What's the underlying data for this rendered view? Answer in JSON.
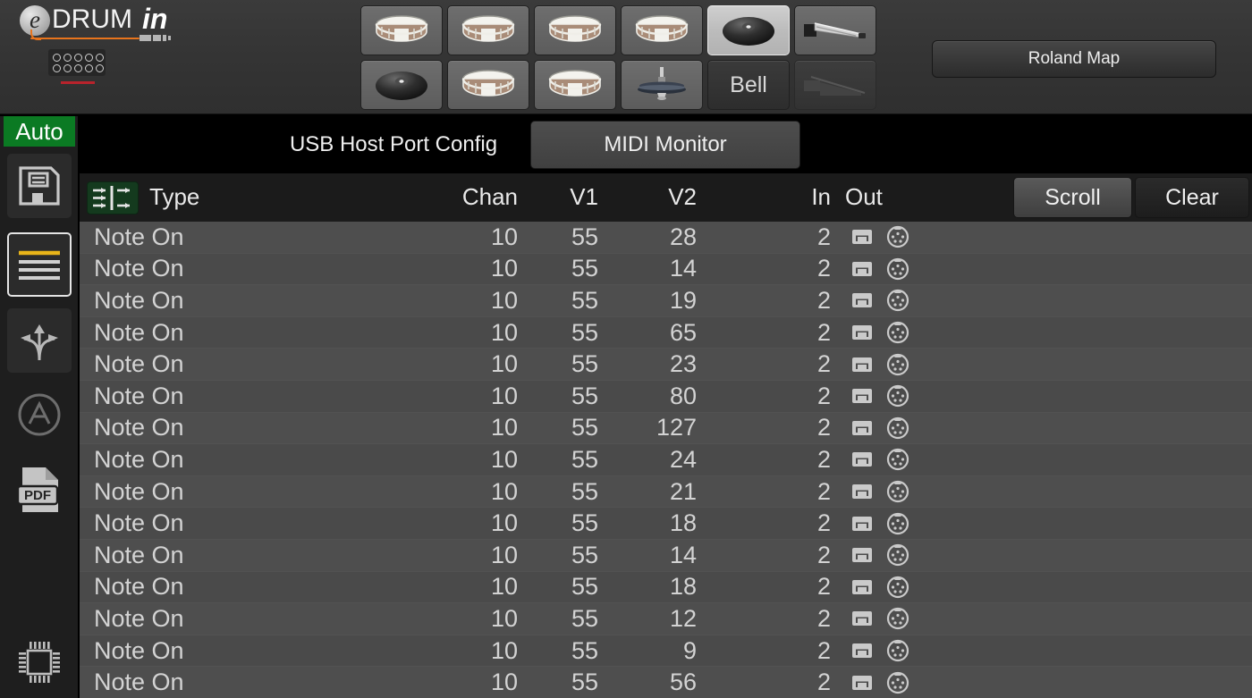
{
  "app": {
    "brand_e": "e",
    "brand_drum": "DRUM",
    "brand_in": "in"
  },
  "colors": {
    "accent_orange": "#e8741c",
    "accent_red": "#b8232c",
    "auto_green": "#0b7a23",
    "filter_green": "#143a1e",
    "table_body_bg": "#4c4c4c",
    "selected_pad_bg": "#bcbcbc"
  },
  "topbar": {
    "pads": {
      "row1": [
        {
          "name": "pad-1",
          "icon": "snare-drum-icon",
          "label": "",
          "state": "normal"
        },
        {
          "name": "pad-2",
          "icon": "snare-drum-icon",
          "label": "",
          "state": "normal"
        },
        {
          "name": "pad-3",
          "icon": "snare-drum-icon",
          "label": "",
          "state": "normal"
        },
        {
          "name": "pad-4",
          "icon": "snare-drum-icon",
          "label": "",
          "state": "normal"
        },
        {
          "name": "pad-5",
          "icon": "cymbal-icon",
          "label": "",
          "state": "selected"
        },
        {
          "name": "pad-6",
          "icon": "hihat-pedal-icon",
          "label": "",
          "state": "normal"
        }
      ],
      "row2": [
        {
          "name": "pad-7",
          "icon": "cymbal-icon",
          "label": "",
          "state": "normal"
        },
        {
          "name": "pad-8",
          "icon": "snare-drum-icon",
          "label": "",
          "state": "normal"
        },
        {
          "name": "pad-9",
          "icon": "snare-drum-icon",
          "label": "",
          "state": "normal"
        },
        {
          "name": "pad-10",
          "icon": "hihat-icon",
          "label": "",
          "state": "normal"
        },
        {
          "name": "pad-11-bell",
          "icon": "",
          "label": "Bell",
          "state": "dark"
        },
        {
          "name": "pad-12",
          "icon": "hihat-pedal-icon",
          "label": "",
          "state": "disabled"
        }
      ]
    },
    "roland_map_label": "Roland Map"
  },
  "sidebar": {
    "auto_label": "Auto",
    "items": [
      {
        "name": "sidebar-item-save",
        "icon": "floppy-disk-icon",
        "active": false
      },
      {
        "name": "sidebar-item-list",
        "icon": "list-lines-icon",
        "active": true
      },
      {
        "name": "sidebar-item-routing",
        "icon": "routing-arrows-icon",
        "active": false
      },
      {
        "name": "sidebar-item-about",
        "icon": "circled-a-icon",
        "active": false
      },
      {
        "name": "sidebar-item-pdf",
        "icon": "pdf-file-icon",
        "active": false
      },
      {
        "name": "sidebar-item-firmware",
        "icon": "chip-icon",
        "active": false
      }
    ]
  },
  "main": {
    "tabs": [
      {
        "label": "USB Host Port Config",
        "active": false
      },
      {
        "label": "MIDI Monitor",
        "active": true
      }
    ],
    "table": {
      "filter_icon": "midi-filter-icon",
      "columns": [
        "Type",
        "Chan",
        "V1",
        "V2",
        "In",
        "Out"
      ],
      "buttons": [
        {
          "label": "Scroll",
          "active": true
        },
        {
          "label": "Clear",
          "active": false
        }
      ],
      "out_icons": [
        "usb-port-icon",
        "midi-din-icon"
      ],
      "rows": [
        {
          "type": "Note On",
          "chan": "10",
          "v1": "55",
          "v2": "28",
          "in": "2"
        },
        {
          "type": "Note On",
          "chan": "10",
          "v1": "55",
          "v2": "14",
          "in": "2"
        },
        {
          "type": "Note On",
          "chan": "10",
          "v1": "55",
          "v2": "19",
          "in": "2"
        },
        {
          "type": "Note On",
          "chan": "10",
          "v1": "55",
          "v2": "65",
          "in": "2"
        },
        {
          "type": "Note On",
          "chan": "10",
          "v1": "55",
          "v2": "23",
          "in": "2"
        },
        {
          "type": "Note On",
          "chan": "10",
          "v1": "55",
          "v2": "80",
          "in": "2"
        },
        {
          "type": "Note On",
          "chan": "10",
          "v1": "55",
          "v2": "127",
          "in": "2"
        },
        {
          "type": "Note On",
          "chan": "10",
          "v1": "55",
          "v2": "24",
          "in": "2"
        },
        {
          "type": "Note On",
          "chan": "10",
          "v1": "55",
          "v2": "21",
          "in": "2"
        },
        {
          "type": "Note On",
          "chan": "10",
          "v1": "55",
          "v2": "18",
          "in": "2"
        },
        {
          "type": "Note On",
          "chan": "10",
          "v1": "55",
          "v2": "14",
          "in": "2"
        },
        {
          "type": "Note On",
          "chan": "10",
          "v1": "55",
          "v2": "18",
          "in": "2"
        },
        {
          "type": "Note On",
          "chan": "10",
          "v1": "55",
          "v2": "12",
          "in": "2"
        },
        {
          "type": "Note On",
          "chan": "10",
          "v1": "55",
          "v2": "9",
          "in": "2"
        },
        {
          "type": "Note On",
          "chan": "10",
          "v1": "55",
          "v2": "56",
          "in": "2"
        }
      ]
    }
  }
}
